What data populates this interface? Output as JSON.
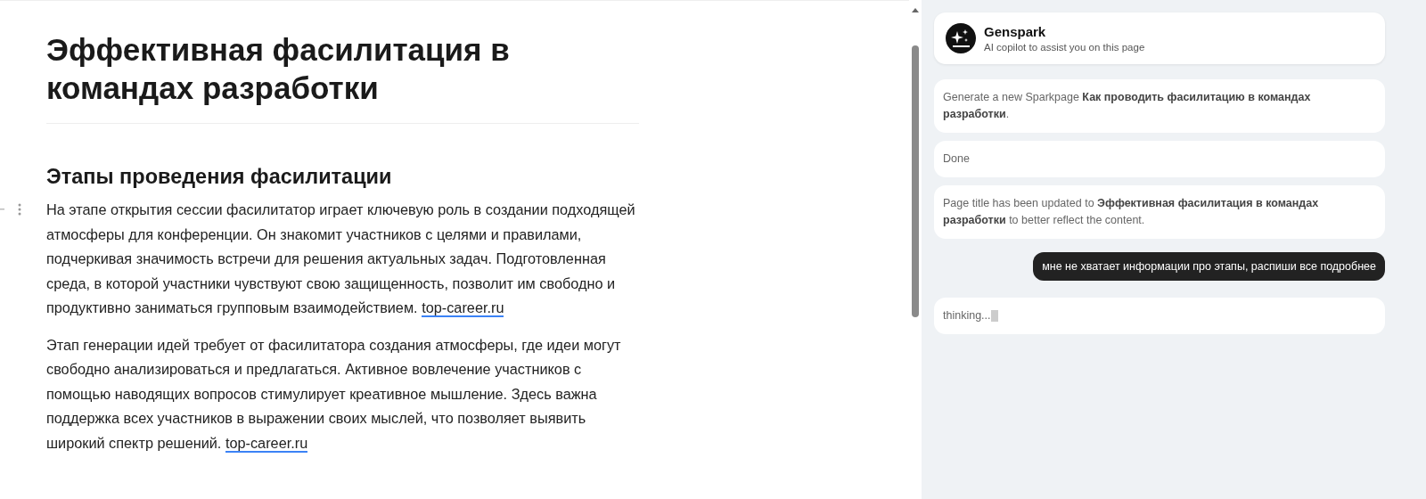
{
  "article": {
    "title": "Эффективная фасилитация в командах разработки",
    "section_heading": "Этапы проведения фасилитации",
    "paragraphs": [
      {
        "text": "На этапе открытия сессии фасилитатор играет ключевую роль в создании подходящей атмосферы для конференции. Он знакомит участников с целями и правилами, подчеркивая значимость встречи для решения актуальных задач. Подготовленная среда, в которой участники чувствуют свою защищенность, позволит им свободно и продуктивно заниматься групповым взаимодействием.",
        "link": "top-career.ru"
      },
      {
        "text": "Этап генерации идей требует от фасилитатора создания атмосферы, где идеи могут свободно анализироваться и предлагаться. Активное вовлечение участников с помощью наводящих вопросов стимулирует креативное мышление. Здесь важна поддержка всех участников в выражении своих мыслей, что позволяет выявить широкий спектр решений.",
        "link": "top-career.ru"
      }
    ]
  },
  "copilot": {
    "name": "Genspark",
    "subtitle": "AI copilot to assist you on this page",
    "messages": [
      {
        "kind": "assistant",
        "text": "Generate a new Sparkpage **Как проводить фасилитацию в командах разработки**."
      },
      {
        "kind": "assistant",
        "text": "Done"
      },
      {
        "kind": "assistant",
        "text": "Page title has been updated to **Эффективная фасилитация в командах разработки** to better reflect the content."
      },
      {
        "kind": "user",
        "text": "мне не хватает информации про этапы, распиши все подробнее"
      },
      {
        "kind": "thinking",
        "text": "thinking...",
        "streaming": true
      }
    ]
  }
}
